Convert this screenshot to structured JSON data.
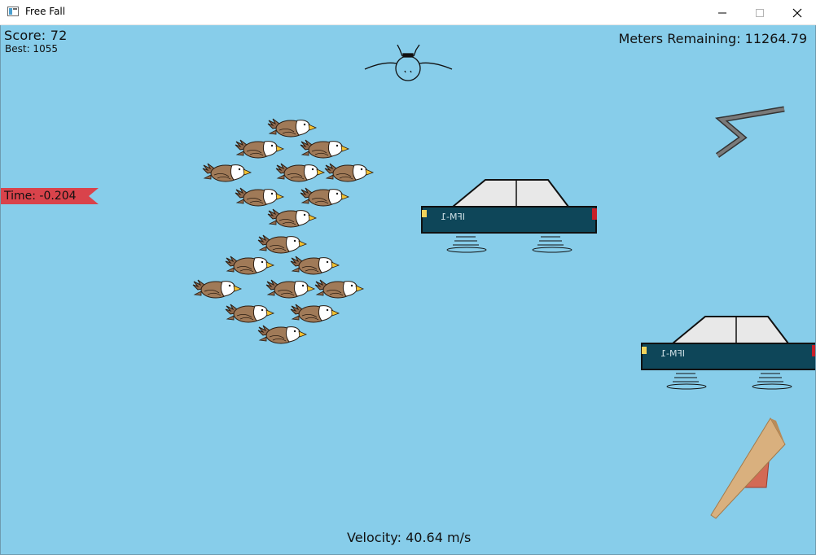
{
  "window": {
    "title": "Free Fall"
  },
  "hud": {
    "score_label": "Score: 72",
    "best_label": "Best: 1055",
    "meters_label": "Meters Remaining: 11264.79",
    "time_label": "Time: -0.204",
    "velocity_label": "Velocity: 40.64 m/s"
  },
  "cars": [
    {
      "plate": "IFM-1"
    },
    {
      "plate": "IFM-1"
    }
  ],
  "colors": {
    "sky": "#87cdea",
    "car_body": "#0e4659",
    "car_roof": "#e8e8e8",
    "flag": "#d9434b",
    "eagle_brown": "#8e6a4e",
    "eagle_beak": "#f2c230"
  },
  "icons": [
    "app-icon",
    "minimize-icon",
    "maximize-icon",
    "close-icon"
  ]
}
